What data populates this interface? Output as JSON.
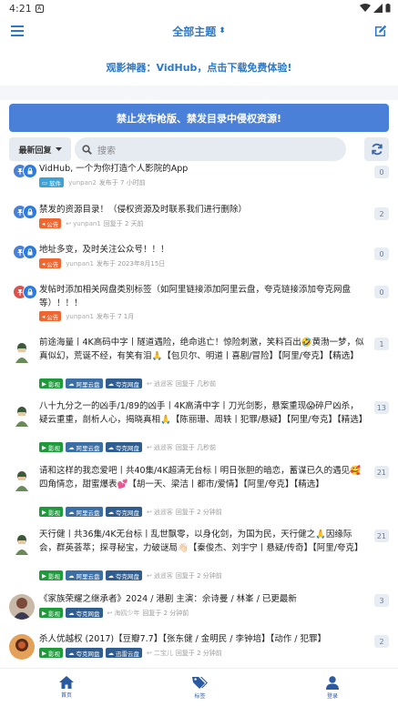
{
  "status": {
    "time": "4:21",
    "a_badge": "A"
  },
  "header": {
    "title": "全部主题",
    "title_caret": "⬍"
  },
  "banner": {
    "text": "观影神器：VidHub，点击下载免费体验!"
  },
  "notice": {
    "text": "禁止发布枪版、禁发目录中侵权资源!"
  },
  "filter": {
    "sort_label": "最新回复",
    "search_placeholder": "搜索"
  },
  "colors": {
    "accent": "#2c78c7",
    "notice_bg": "#4a80d8",
    "tag_movie": "#1d9a3a",
    "tag_notice": "#f0662e",
    "tag_soft": "#3aa3d8"
  },
  "threads": [
    {
      "title": "VidHub, 一个为你打造个人影院的App",
      "tags": [
        "软件"
      ],
      "author": "yunpan2",
      "time": "发布于 7 小时前",
      "count": "0",
      "pinned": true
    },
    {
      "title": "禁发的资源目录！（侵权资源及时联系我们进行删除）",
      "tags": [
        "公告"
      ],
      "author": "yunpan1",
      "time": "回复于 2 天前",
      "count": "2",
      "pinned": true
    },
    {
      "title": "地址多变，及时关注公众号！！！",
      "tags": [
        "公告"
      ],
      "author": "yunpan1",
      "time": "发布于 2023年8月15日",
      "count": "0",
      "pinned": true
    },
    {
      "title": "发帖时添加相关网盘类别标签（如阿里链接添加阿里云盘，夸克链接添加夸克网盘等）！！！",
      "tags": [
        "公告"
      ],
      "author": "yunpan1",
      "time": "发布于 7 1月",
      "count": "0",
      "pinned": true
    },
    {
      "title": "前途海量丨4K高码中字丨隧道遇险，绝命逃亡！惊险刺激，笑料百出🤣黄渤一梦，似真似幻，荒诞不经，有笑有泪🙏【包贝尔、明道丨喜剧/冒险】【阿里/夸克】【精选】",
      "tags": [
        "影视",
        "阿里云盘",
        "夸克网盘"
      ],
      "author": "逍遥客",
      "time": "回复于 几秒前",
      "count": "1"
    },
    {
      "title": "八十九分之一的凶手/1/89的凶手丨4K高清中字丨刀光剑影，悬案重现😱碎尸凶杀，疑云重重，剖析人心，揭晓真相🙏【陈丽珊、周轶丨犯罪/悬疑】【阿里/夸克】【精选】",
      "tags": [
        "影视",
        "阿里云盘",
        "夸克网盘"
      ],
      "author": "逍遥客",
      "time": "回复于 几秒前",
      "count": "13"
    },
    {
      "title": "请和这样的我恋爱吧丨共40集/4K超清无台标丨明日张胆的暗恋，蓄谋已久的遇见🥰四角情恋，甜蜜爆表💕【胡一天、梁洁丨都市/爱情】【阿里/夸克】【精选】",
      "tags": [
        "影视",
        "阿里云盘",
        "夸克网盘"
      ],
      "author": "逍遥客",
      "time": "回复于 2 分钟前",
      "count": "21"
    },
    {
      "title": "天行健丨共36集/4K无台标丨乱世飘零，以身化剑，为国为民，天行健之🙏因缘际会，群英荟萃；探寻秘宝，力破谜局👋🏻【秦俊杰、刘宇宁丨悬疑/传奇】【阿里/夸克】",
      "tags": [
        "影视",
        "阿里云盘",
        "夸克网盘"
      ],
      "author": "逍遥客",
      "time": "回复于 2 分钟前",
      "count": "21"
    },
    {
      "title": "《家族荣耀之继承者》2024 / 港剧 主演：佘诗曼 / 林峯 / 已更最新",
      "tags": [
        "影视",
        "夸克网盘"
      ],
      "author": "海鸥少年",
      "time": "回复于 2 分钟前",
      "count": "3"
    },
    {
      "title": "杀人优越权 (2017)【豆瓣7.7】【张东健 / 金明民 / 李钟培】【动作 / 犯罪】",
      "tags": [
        "影视",
        "夸克网盘",
        "迅雷云盘"
      ],
      "author": "二宝儿",
      "time": "回复于 2 分钟前",
      "count": "2"
    }
  ],
  "nav": {
    "home": "首页",
    "tags": "标签",
    "login": "登录"
  }
}
